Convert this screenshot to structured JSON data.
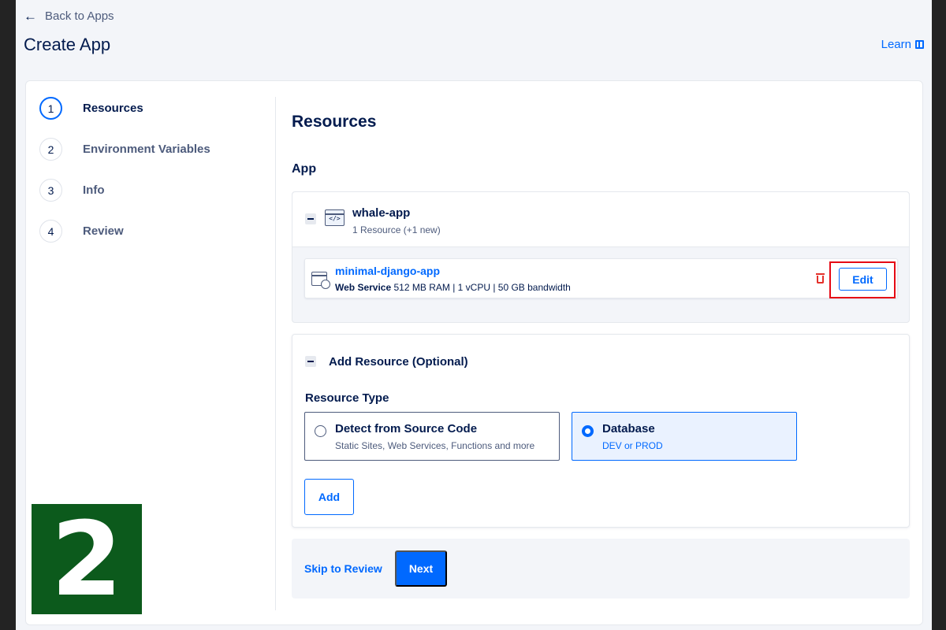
{
  "header": {
    "back_label": "Back to Apps",
    "title": "Create App",
    "learn_label": "Learn"
  },
  "stepper": {
    "steps": [
      {
        "number": "1",
        "label": "Resources",
        "active": true
      },
      {
        "number": "2",
        "label": "Environment Variables",
        "active": false
      },
      {
        "number": "3",
        "label": "Info",
        "active": false
      },
      {
        "number": "4",
        "label": "Review",
        "active": false
      }
    ]
  },
  "main": {
    "title": "Resources",
    "app_section_label": "App",
    "app": {
      "name": "whale-app",
      "meta": "1 Resource (+1 new)",
      "icon": "code-window-icon",
      "component": {
        "name": "minimal-django-app",
        "type": "Web Service",
        "spec": "512 MB RAM | 1 vCPU | 50 GB bandwidth",
        "icon": "web-service-globe-icon",
        "edit_label": "Edit"
      }
    },
    "add_resource": {
      "title": "Add Resource (Optional)",
      "type_label": "Resource Type",
      "options": [
        {
          "title": "Detect from Source Code",
          "subtitle": "Static Sites, Web Services, Functions and more",
          "selected": false
        },
        {
          "title": "Database",
          "subtitle": "DEV or PROD",
          "selected": true
        }
      ],
      "add_label": "Add"
    },
    "footer": {
      "skip_label": "Skip to Review",
      "next_label": "Next"
    }
  },
  "overlay": {
    "step_number": "2"
  },
  "colors": {
    "accent": "#0069ff",
    "danger": "#e4312a",
    "highlight": "#e50914",
    "badge": "#0c5a1c"
  }
}
